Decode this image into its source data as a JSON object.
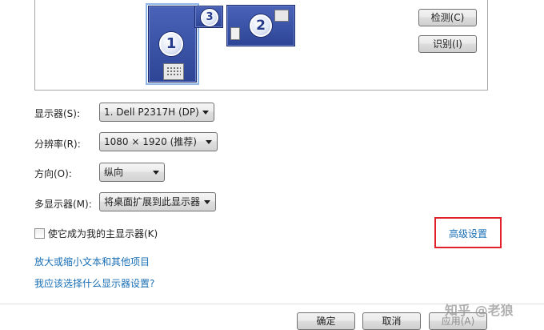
{
  "arrangement": {
    "monitors": [
      {
        "number": "1"
      },
      {
        "number": "3"
      },
      {
        "number": "2"
      }
    ]
  },
  "buttons": {
    "detect": "检测(C)",
    "identify": "识别(I)",
    "ok": "确定",
    "cancel": "取消",
    "apply": "应用(A)"
  },
  "form": {
    "display_label": "显示器(S):",
    "display_value": "1. Dell P2317H (DP)",
    "resolution_label": "分辨率(R):",
    "resolution_value": "1080 × 1920 (推荐)",
    "orientation_label": "方向(O):",
    "orientation_value": "纵向",
    "multi_label": "多显示器(M):",
    "multi_value": "将桌面扩展到此显示器"
  },
  "primary_checkbox": {
    "label": "使它成为我的主显示器(K)",
    "checked": false
  },
  "links": {
    "advanced": "高级设置",
    "text_size": "放大或缩小文本和其他项目",
    "which_settings": "我应该选择什么显示器设置?"
  },
  "watermark": "知乎 @老狼",
  "colors": {
    "monitor_blue": "#3a54a8",
    "link": "#1a6fb5",
    "highlight_red": "#e0202a"
  }
}
